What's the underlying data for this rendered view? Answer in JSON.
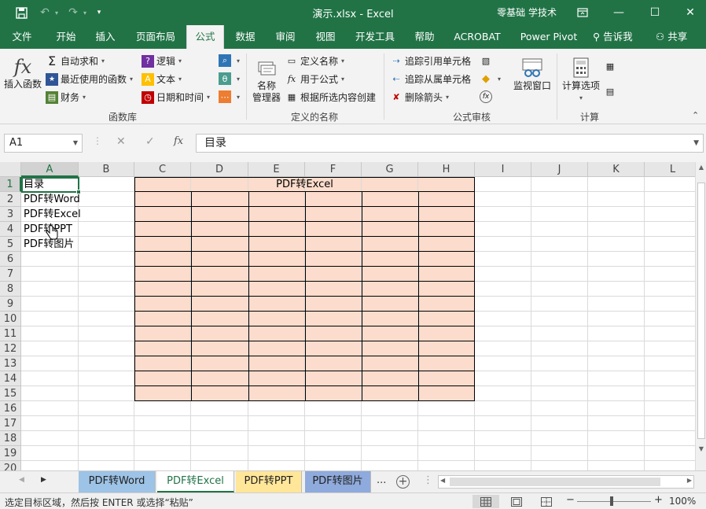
{
  "window": {
    "title": "演示.xlsx  -  Excel",
    "user": "零基础 学技术",
    "buttons": {
      "minimize": "—",
      "maximize": "☐",
      "close": "✕",
      "restore_ribbon": "⧉"
    }
  },
  "tabs": [
    {
      "label": "文件"
    },
    {
      "label": "开始"
    },
    {
      "label": "插入"
    },
    {
      "label": "页面布局"
    },
    {
      "label": "公式"
    },
    {
      "label": "数据"
    },
    {
      "label": "审阅"
    },
    {
      "label": "视图"
    },
    {
      "label": "开发工具"
    },
    {
      "label": "帮助"
    },
    {
      "label": "ACROBAT"
    },
    {
      "label": "Power Pivot"
    }
  ],
  "tell_me": "告诉我",
  "share": "共享",
  "ribbon": {
    "function_library": {
      "label": "函数库",
      "insert_function": "插入函数",
      "autosum": "自动求和",
      "recent": "最近使用的函数",
      "financial": "财务",
      "logical": "逻辑",
      "text": "文本",
      "datetime": "日期和时间"
    },
    "defined_names": {
      "label": "定义的名称",
      "name_manager_1": "名称",
      "name_manager_2": "管理器",
      "define_name": "定义名称",
      "use_in_formula": "用于公式",
      "create_from_selection": "根据所选内容创建"
    },
    "formula_auditing": {
      "label": "公式审核",
      "trace_precedents": "追踪引用单元格",
      "trace_dependents": "追踪从属单元格",
      "remove_arrows": "删除箭头",
      "watch_window": "监视窗口"
    },
    "calculation": {
      "label": "计算",
      "calc_options": "计算选项"
    }
  },
  "formula_bar": {
    "name_box": "A1",
    "cancel": "✕",
    "enter": "✓",
    "fx": "fx",
    "content": "目录"
  },
  "columns": [
    "A",
    "B",
    "C",
    "D",
    "E",
    "F",
    "G",
    "H",
    "I",
    "J",
    "K",
    "L"
  ],
  "rows": [
    "1",
    "2",
    "3",
    "4",
    "5",
    "6",
    "7",
    "8",
    "9",
    "10",
    "11",
    "12",
    "13",
    "14",
    "15",
    "16",
    "17",
    "18",
    "19",
    "20"
  ],
  "cells": {
    "A1": "目录",
    "A2": "PDF转Word",
    "A3": "PDF转Excel",
    "A4": "PDF转PPT",
    "A5": "PDF转图片",
    "C1_merged": "PDF转Excel"
  },
  "sheets": [
    {
      "label": "PDF转Word",
      "color": "#9dc3e6"
    },
    {
      "label": "PDF转Excel",
      "color": "#ffffff"
    },
    {
      "label": "PDF转PPT",
      "color": "#ffe699"
    },
    {
      "label": "PDF转图片",
      "color": "#8faadc"
    }
  ],
  "sheet_more": "...",
  "status": {
    "message": "选定目标区域，然后按 ENTER 或选择“粘贴”",
    "zoom": "100%",
    "zoom_minus": "−",
    "zoom_plus": "+"
  },
  "colors": {
    "accent": "#217346",
    "table_fill": "#fcdccc"
  }
}
